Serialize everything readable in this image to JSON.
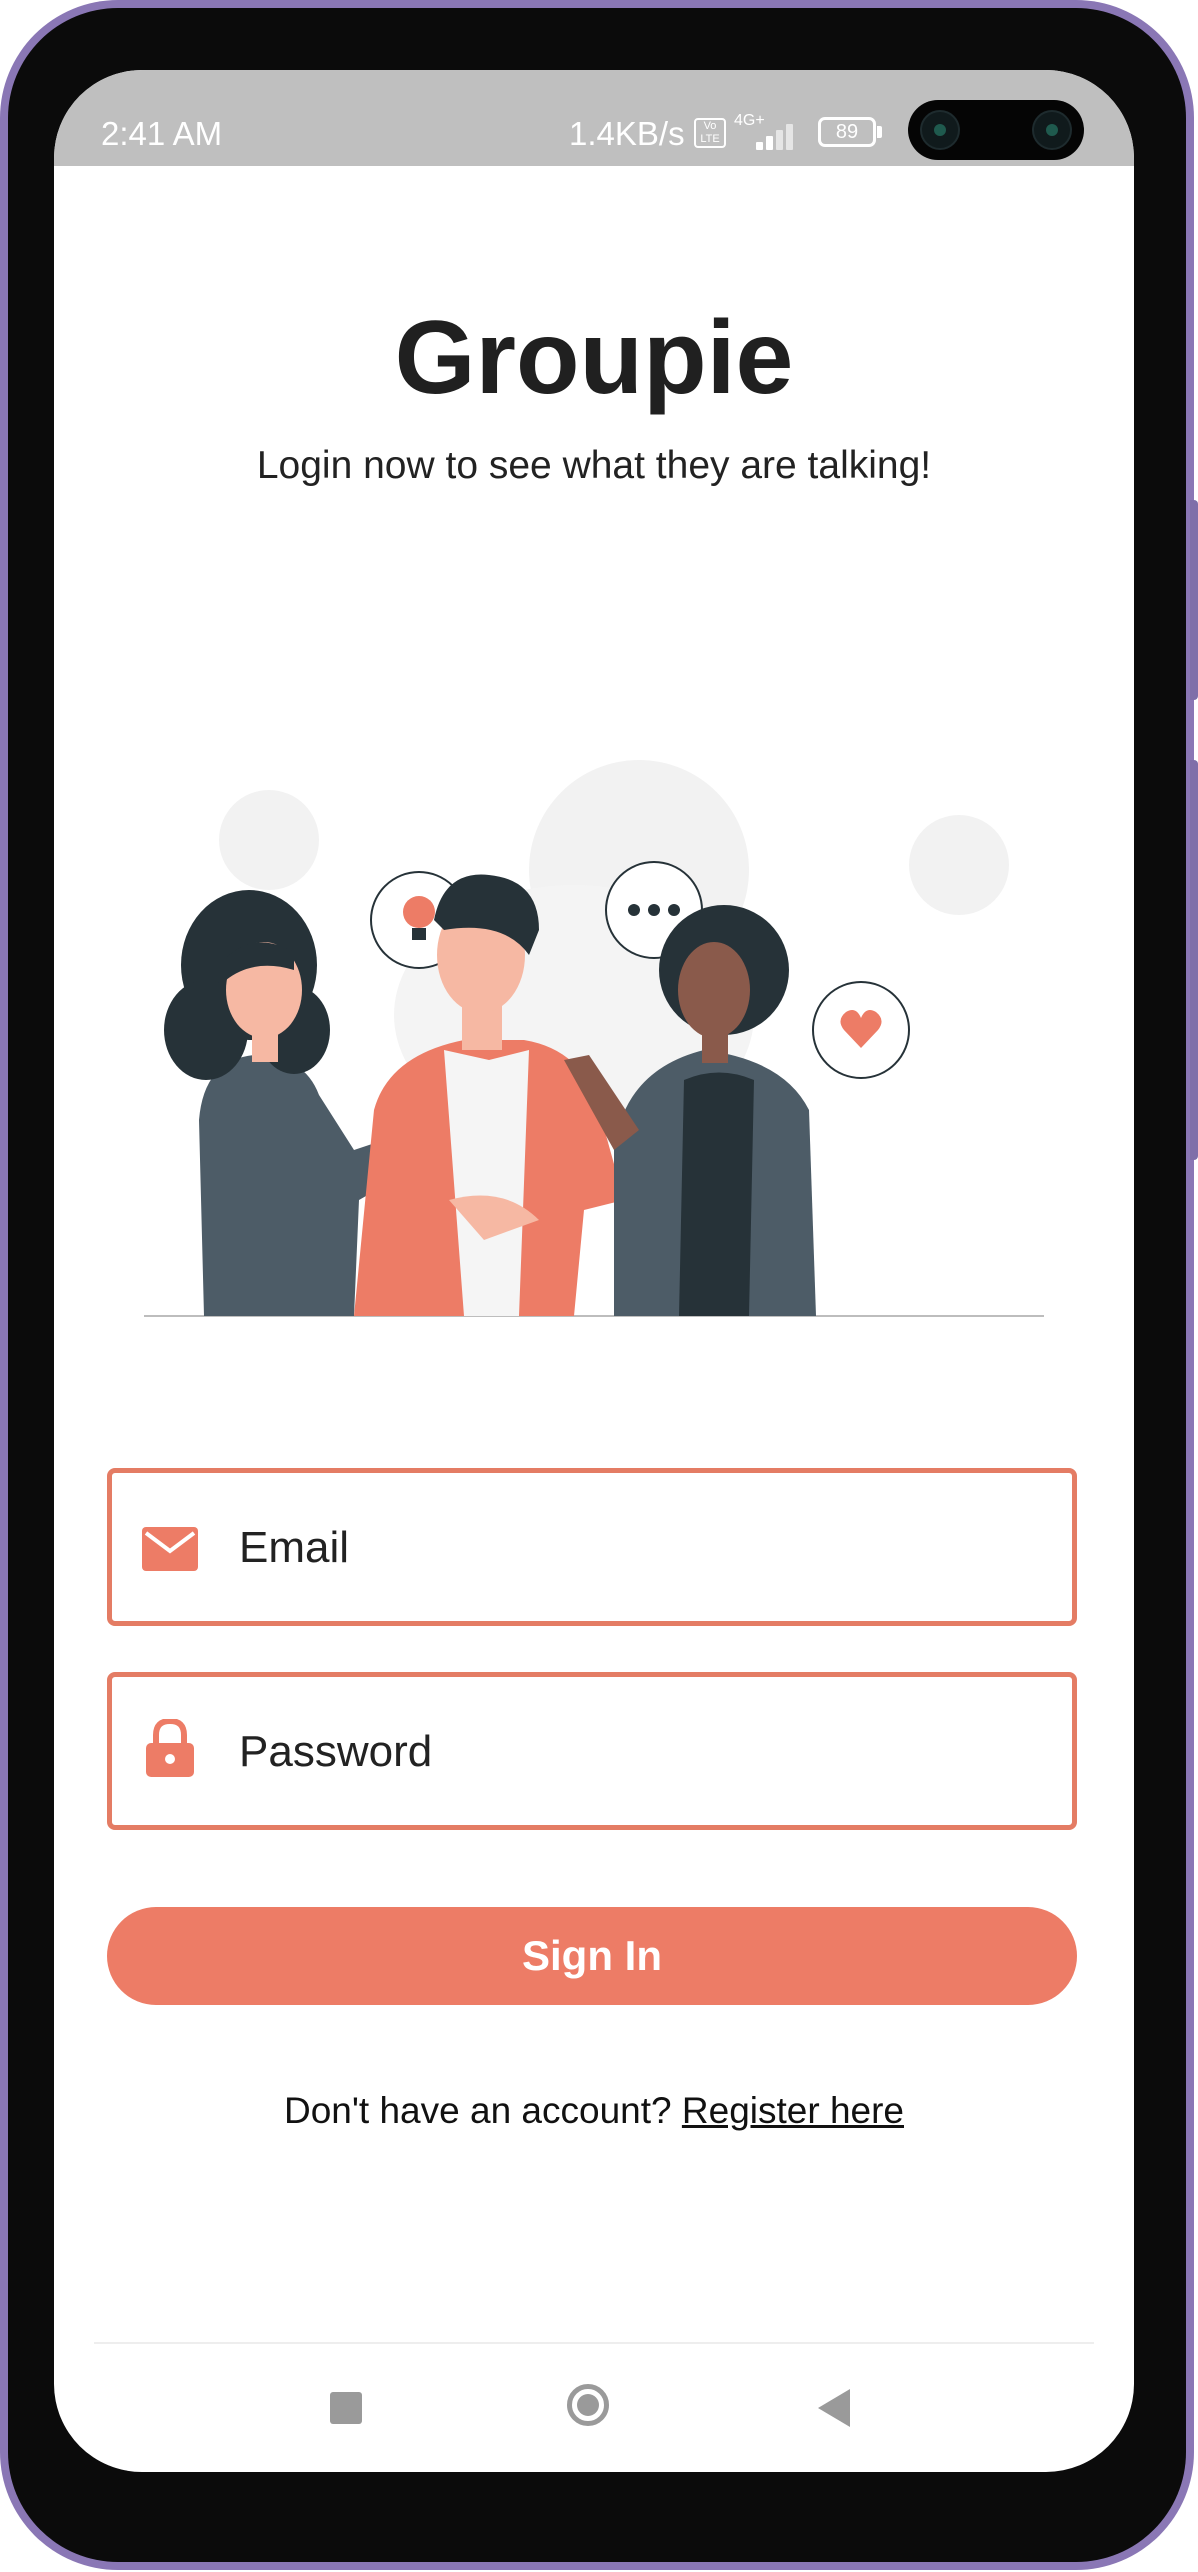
{
  "status_bar": {
    "time": "2:41 AM",
    "network_speed": "1.4KB/s",
    "volte": "Vo LTE",
    "network_type": "4G+",
    "battery": "89"
  },
  "app": {
    "title": "Groupie",
    "subtitle": "Login now to see what they are talking!"
  },
  "form": {
    "email_placeholder": "Email",
    "password_placeholder": "Password",
    "signin_label": "Sign In",
    "register_prompt": "Don't have an account? ",
    "register_link": "Register here"
  },
  "icons": {
    "email": "mail-icon",
    "password": "lock-icon",
    "nav_recent": "square-icon",
    "nav_home": "circle-icon",
    "nav_back": "triangle-back-icon"
  },
  "colors": {
    "accent": "#ed7c66",
    "field_border": "#e47c64",
    "title_text": "#202020",
    "status_bar": "#bfbfbf"
  }
}
